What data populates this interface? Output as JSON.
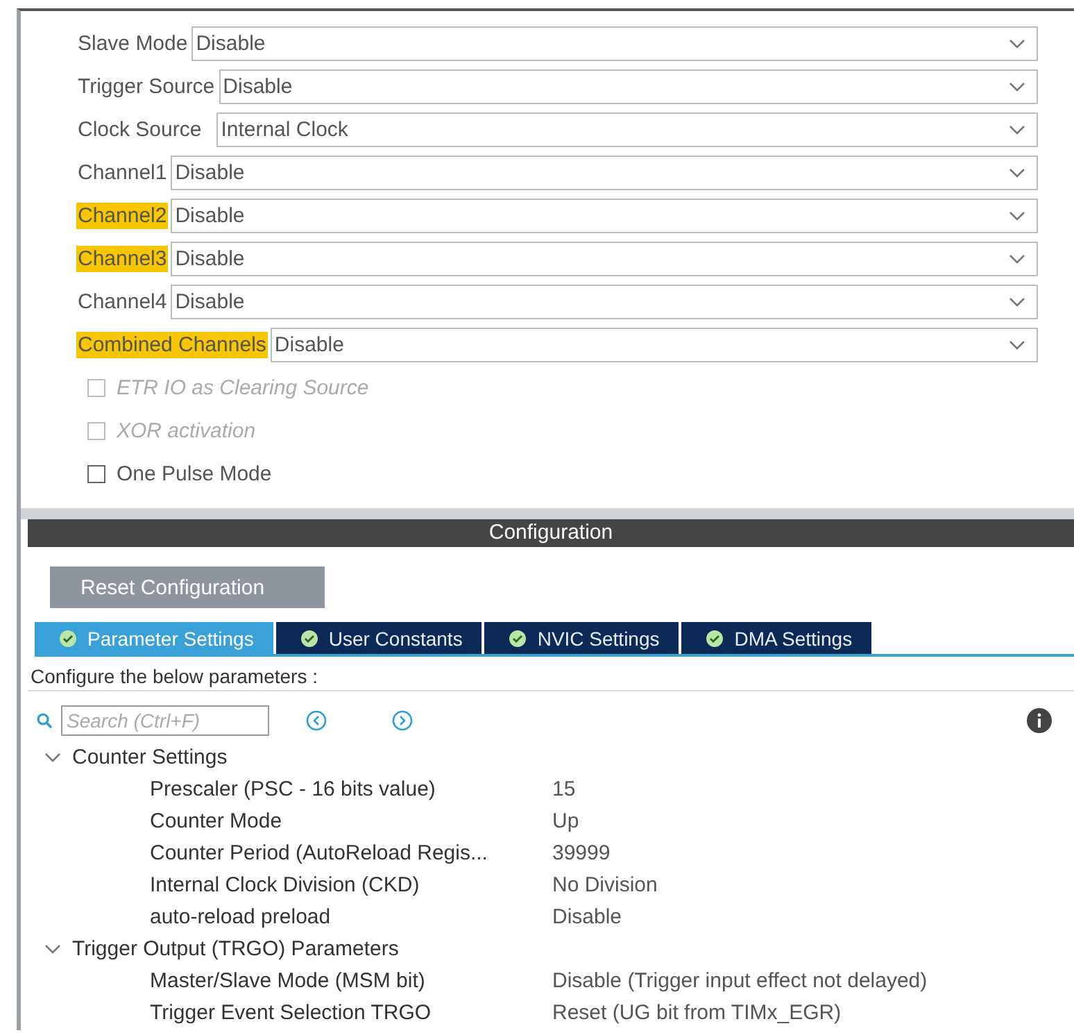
{
  "mode_fields": [
    {
      "label": "Slave Mode",
      "value": "Disable",
      "highlighted": false
    },
    {
      "label": "Trigger Source",
      "value": "Disable",
      "highlighted": false
    },
    {
      "label": "Clock Source",
      "value": "Internal Clock",
      "highlighted": false
    },
    {
      "label": "Channel1",
      "value": "Disable",
      "highlighted": false
    },
    {
      "label": "Channel2",
      "value": "Disable",
      "highlighted": true
    },
    {
      "label": "Channel3",
      "value": "Disable",
      "highlighted": true
    },
    {
      "label": "Channel4",
      "value": "Disable",
      "highlighted": false
    },
    {
      "label": "Combined Channels",
      "value": "Disable",
      "highlighted": true
    }
  ],
  "options": [
    {
      "label": "ETR IO as Clearing Source",
      "checked": false,
      "disabled": true
    },
    {
      "label": "XOR activation",
      "checked": false,
      "disabled": true
    },
    {
      "label": "One Pulse Mode",
      "checked": false,
      "disabled": false
    }
  ],
  "configuration": {
    "title": "Configuration",
    "reset_button": "Reset Configuration",
    "tabs": [
      {
        "label": "Parameter Settings",
        "selected": true
      },
      {
        "label": "User Constants",
        "selected": false
      },
      {
        "label": "NVIC Settings",
        "selected": false
      },
      {
        "label": "DMA Settings",
        "selected": false
      }
    ],
    "hint": "Configure the below parameters :",
    "search": {
      "placeholder": "Search (Ctrl+F)"
    },
    "groups": [
      {
        "label": "Counter Settings",
        "expanded": true,
        "children": [
          {
            "name": "Prescaler (PSC - 16 bits value)",
            "value": "15"
          },
          {
            "name": "Counter Mode",
            "value": "Up"
          },
          {
            "name": "Counter Period (AutoReload Regis...",
            "value": "39999"
          },
          {
            "name": "Internal Clock Division (CKD)",
            "value": "No Division"
          },
          {
            "name": "auto-reload preload",
            "value": "Disable"
          }
        ]
      },
      {
        "label": "Trigger Output (TRGO) Parameters",
        "expanded": true,
        "children": [
          {
            "name": "Master/Slave Mode (MSM bit)",
            "value": "Disable (Trigger input effect not delayed)"
          },
          {
            "name": "Trigger Event Selection TRGO",
            "value": "Reset (UG bit from TIMx_EGR)"
          }
        ]
      }
    ]
  }
}
